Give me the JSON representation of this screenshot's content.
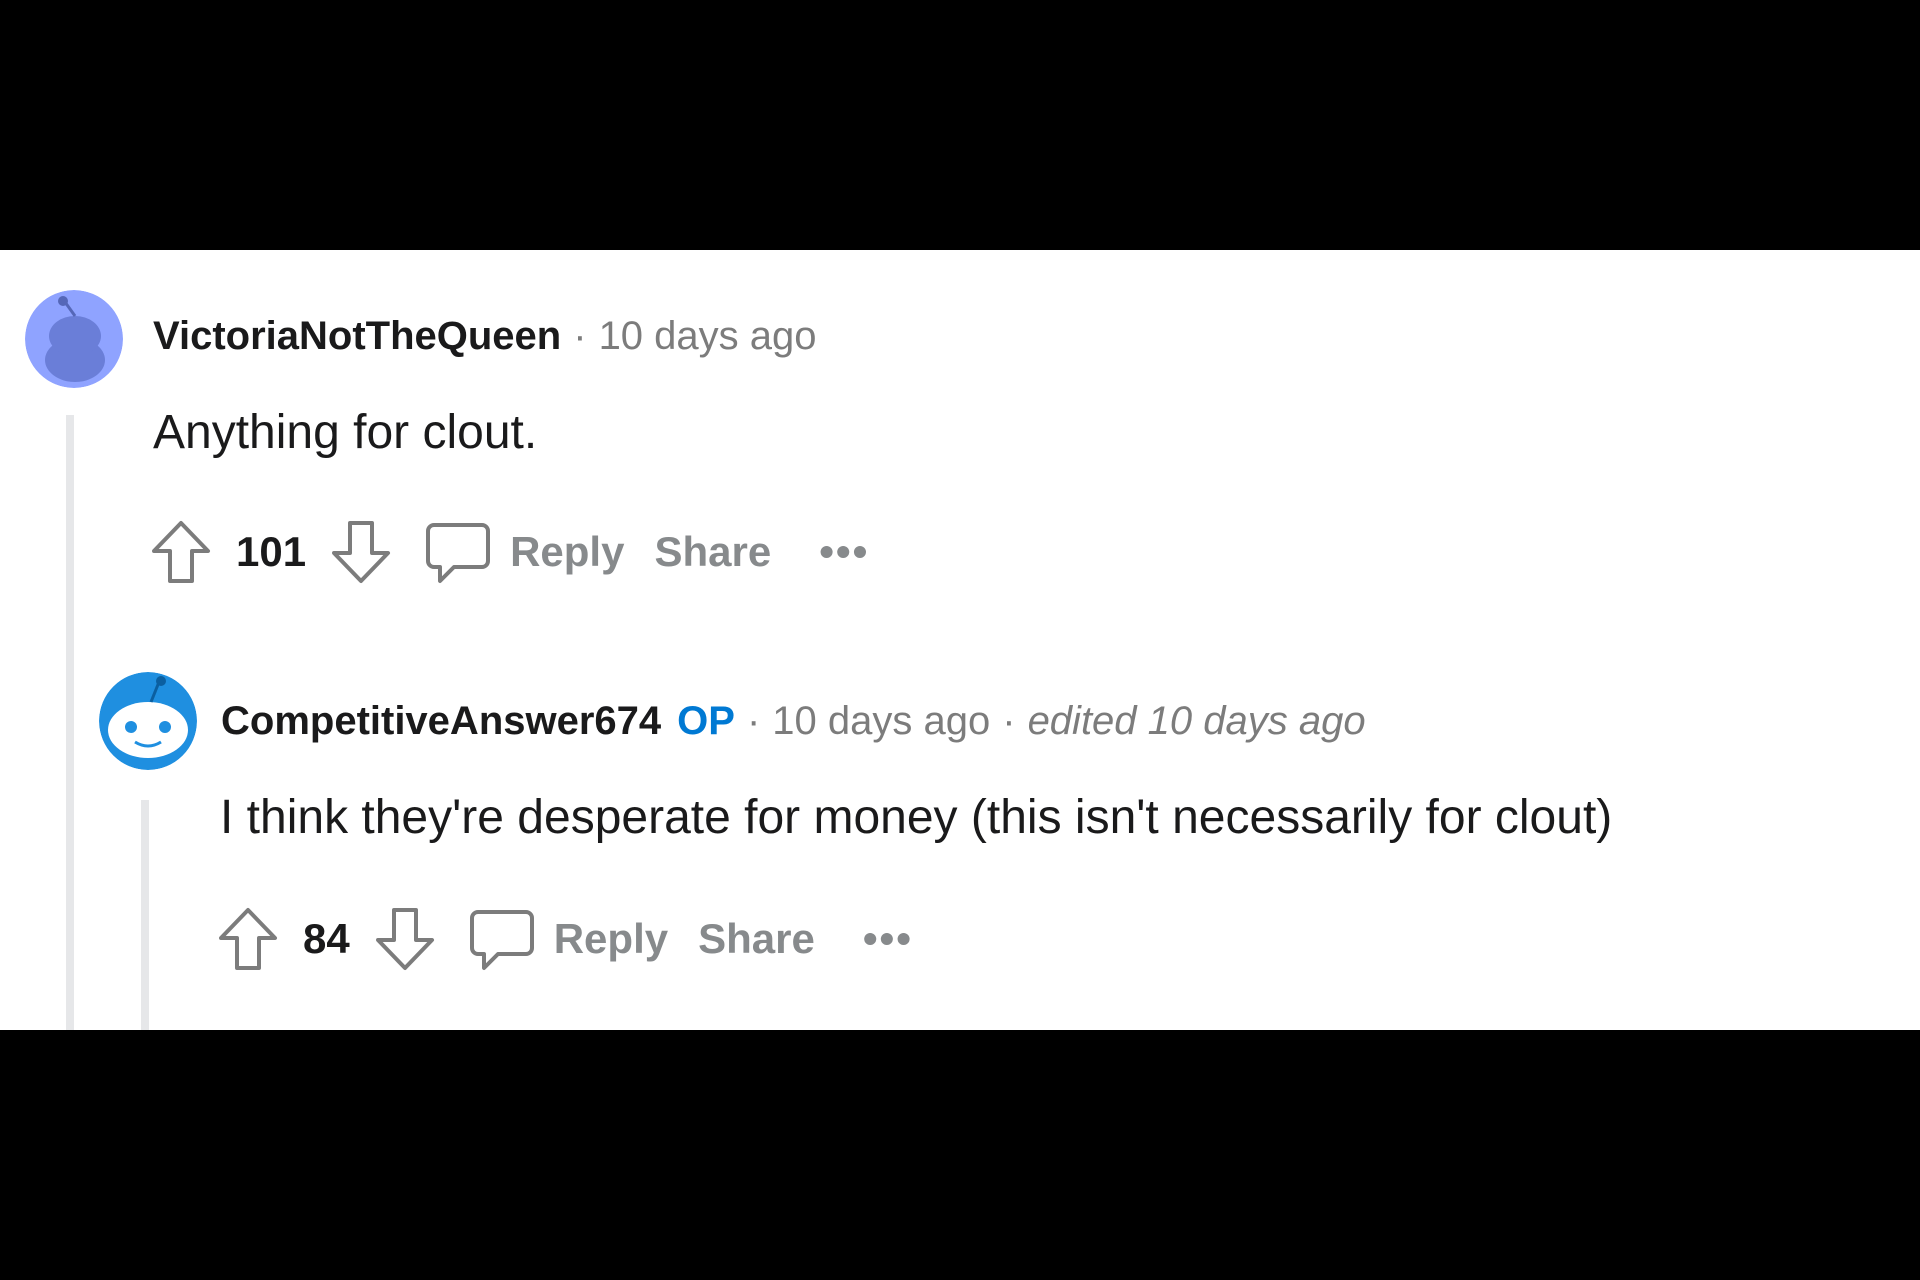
{
  "comments": [
    {
      "author": "VictoriaNotTheQueen",
      "op_badge": "",
      "separator": "·",
      "time": "10 days ago",
      "edited": "",
      "body": "Anything for clout.",
      "votes": "101",
      "reply_label": "Reply",
      "share_label": "Share",
      "more_label": "•••",
      "avatar_color": "#7193ff"
    },
    {
      "author": "CompetitiveAnswer674",
      "op_badge": "OP",
      "separator": "·",
      "time": "10 days ago",
      "edited": "edited 10 days ago",
      "body": "I think they're desperate for money (this isn't necessarily for clout)",
      "votes": "84",
      "reply_label": "Reply",
      "share_label": "Share",
      "more_label": "•••",
      "avatar_color": "#0dd3bb"
    }
  ],
  "colors": {
    "accent_op": "#0079d3",
    "text": "#1a1a1b",
    "muted": "#878a8c",
    "thread_line": "#e6e7e9",
    "background": "#ffffff",
    "letterbox": "#000000"
  }
}
